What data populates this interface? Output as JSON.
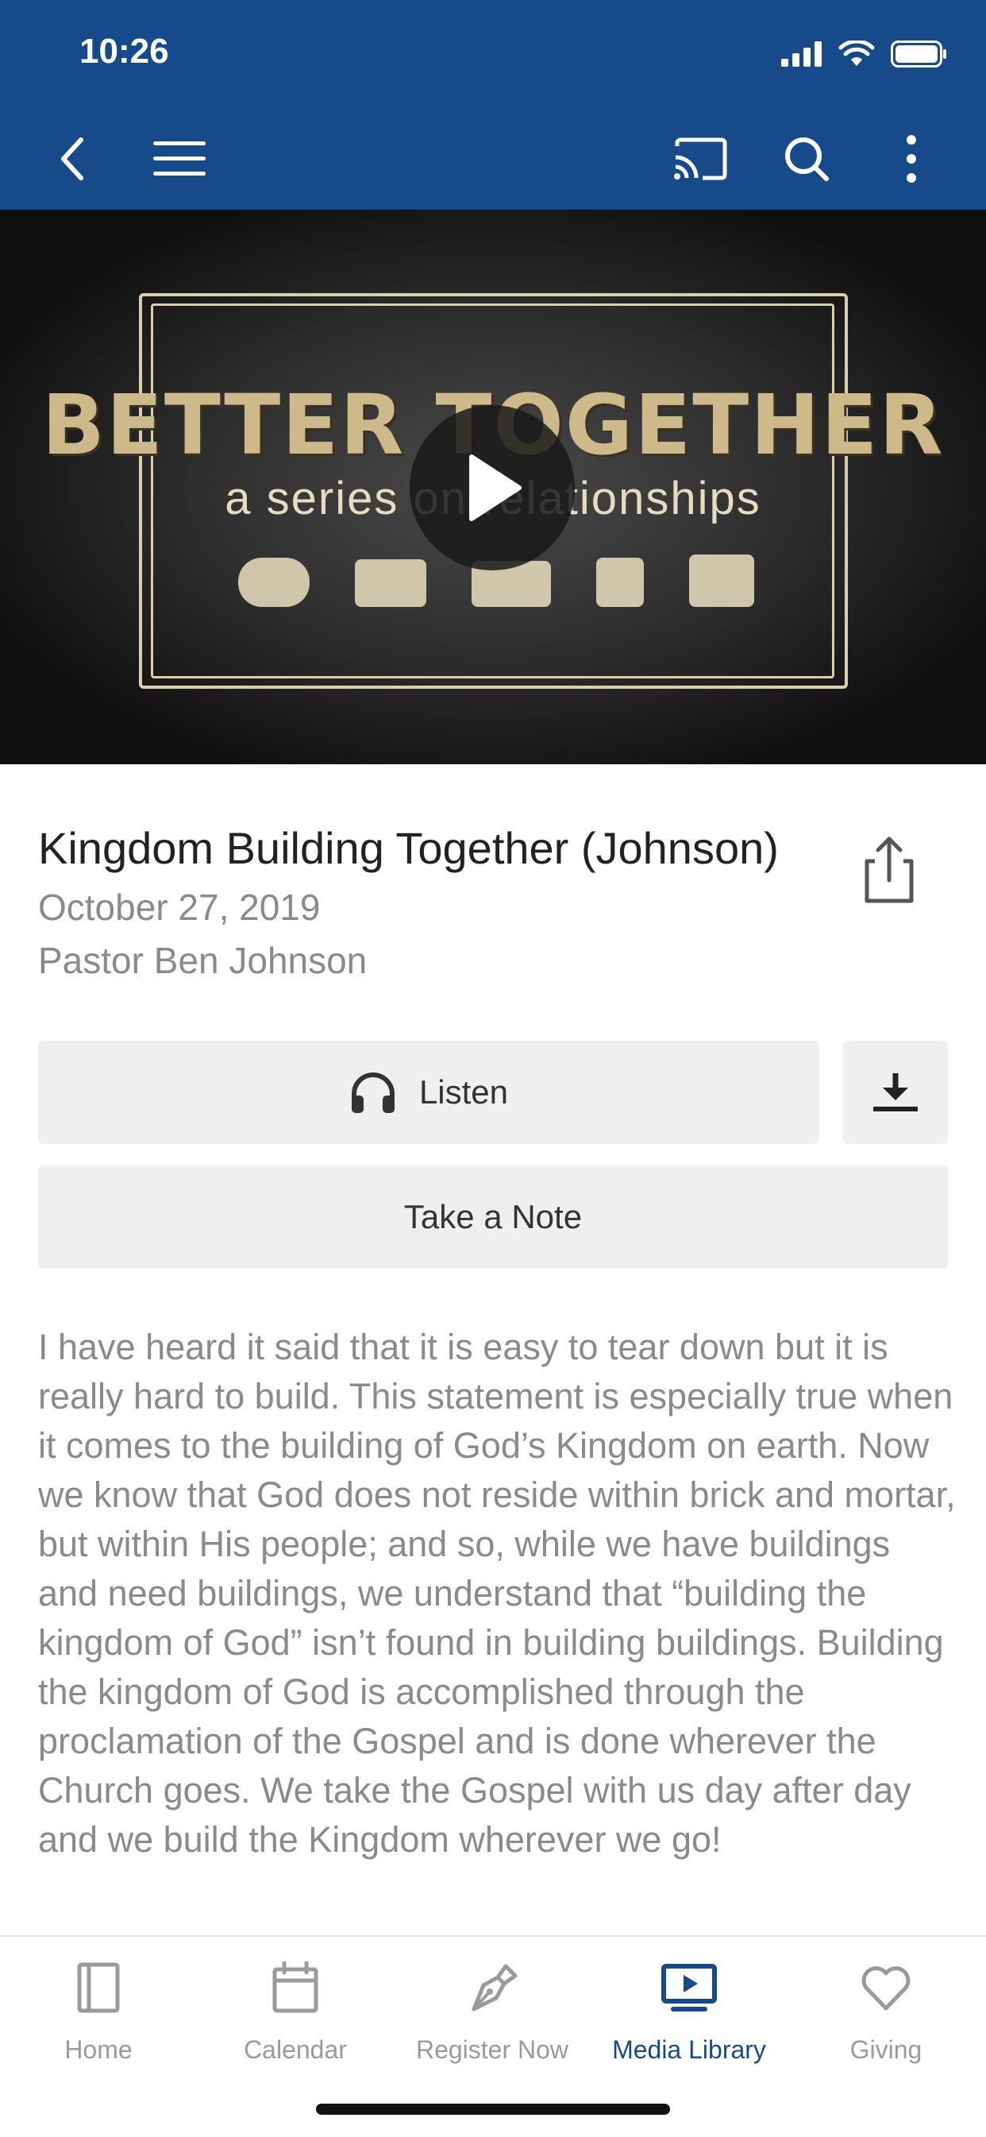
{
  "status": {
    "time": "10:26"
  },
  "video": {
    "title_art": "BETTER TOGETHER",
    "subtitle_art": "a series on relationships"
  },
  "sermon": {
    "title": "Kingdom Building Together (Johnson)",
    "date": "October 27, 2019",
    "speaker": "Pastor Ben Johnson"
  },
  "actions": {
    "listen_label": "Listen",
    "note_label": "Take a Note"
  },
  "description": "I have heard it said that it is easy to tear down but it is really hard to build. This statement is especially true when it comes to the building of God’s Kingdom on earth. Now we know that God does not reside within brick and mortar, but within His people; and so, while we have buildings and need buildings, we understand that “building the kingdom of God” isn’t found in building buildings. Building the kingdom of God is accomplished through the proclamation of the Gospel and is done wherever the Church goes. We take the Gospel with us day after day and we build the Kingdom wherever we go!",
  "tabs": [
    {
      "label": "Home",
      "icon": "home-icon"
    },
    {
      "label": "Calendar",
      "icon": "calendar-icon"
    },
    {
      "label": "Register Now",
      "icon": "pen-icon"
    },
    {
      "label": "Media Library",
      "icon": "media-icon"
    },
    {
      "label": "Giving",
      "icon": "heart-icon"
    }
  ],
  "active_tab": "Media Library",
  "colors": {
    "accent": "#174a8b",
    "button_bg": "#eeeff0",
    "muted_text": "#8a8a8a"
  }
}
